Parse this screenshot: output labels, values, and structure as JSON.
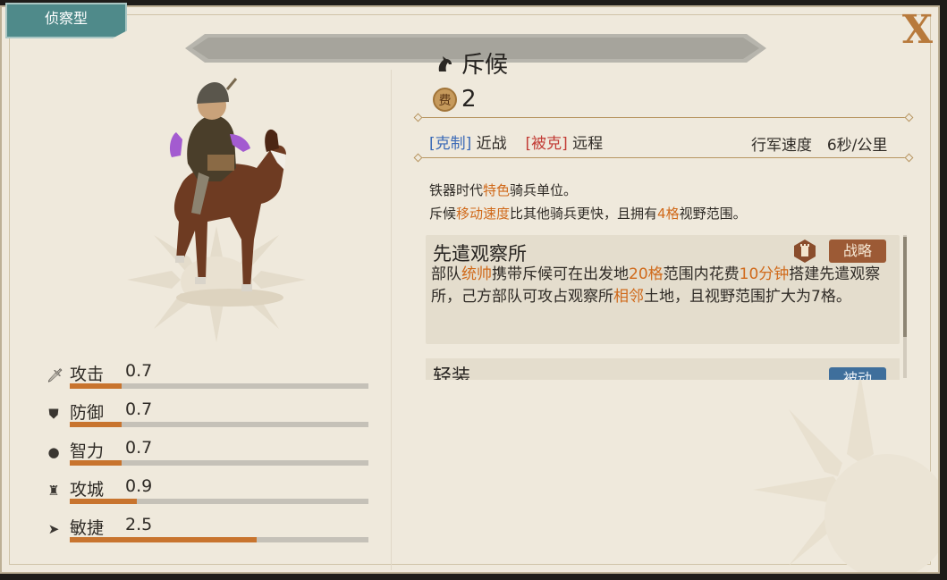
{
  "unit_type_tab": "侦察型",
  "close_label": "X",
  "unit": {
    "name": "斥候",
    "cost_icon_label": "费",
    "cost": "2"
  },
  "counters": {
    "counter_tag": "[克制]",
    "counter_target": "近战",
    "countered_tag": "[被克]",
    "countered_by": "远程"
  },
  "march_speed": {
    "label": "行军速度",
    "value": "6秒/公里"
  },
  "description": {
    "line1_a": "铁器时代",
    "line1_hl": "特色",
    "line1_b": "骑兵单位。",
    "line2_a": "斥候",
    "line2_hl1": "移动速度",
    "line2_b": "比其他骑兵更快，且拥有",
    "line2_hl2": "4格",
    "line2_c": "视野范围。"
  },
  "skills": [
    {
      "title": "先遣观察所",
      "badge": "战略",
      "desc": {
        "p1": "部队",
        "h1": "统帅",
        "p2": "携带斥候可在出发地",
        "h2": "20格",
        "p3": "范围内花费",
        "h3": "10分钟",
        "p4": "搭建先遣观察所，己方部队可攻占观察所",
        "h4": "相邻",
        "p5": "土地，且视野范围扩大为7格。"
      }
    },
    {
      "title": "轻装",
      "badge": "被动"
    }
  ],
  "stats": [
    {
      "label": "攻击",
      "value": "0.7",
      "fraction": 0.175,
      "icon": "sword-icon"
    },
    {
      "label": "防御",
      "value": "0.7",
      "fraction": 0.175,
      "icon": "shield-icon"
    },
    {
      "label": "智力",
      "value": "0.7",
      "fraction": 0.175,
      "icon": "brain-icon"
    },
    {
      "label": "攻城",
      "value": "0.9",
      "fraction": 0.225,
      "icon": "tower-icon"
    },
    {
      "label": "敏捷",
      "value": "2.5",
      "fraction": 0.625,
      "icon": "boot-icon"
    }
  ],
  "colors": {
    "accent_orange": "#d06a1b",
    "counter_blue": "#3a69b6",
    "countered_red": "#c23b35",
    "bar_fill": "#c8742e",
    "strategy_badge": "#9c5a35",
    "passive_badge": "#3f6f9c"
  }
}
